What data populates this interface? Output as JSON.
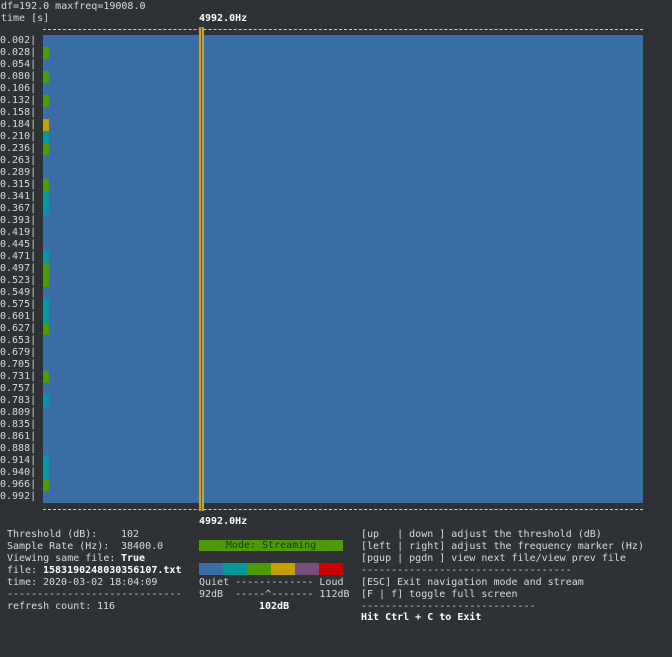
{
  "header": {
    "df_line": "df=192.0 maxfreq=19008.0",
    "time_label": "time [s]",
    "freq_marker_top": "4992.0Hz",
    "freq_marker_bottom": "4992.0Hz"
  },
  "time_labels": [
    "0.002|",
    "0.028|",
    "0.054|",
    "0.080|",
    "0.106|",
    "0.132|",
    "0.158|",
    "0.184|",
    "0.210|",
    "0.236|",
    "0.263|",
    "0.289|",
    "0.315|",
    "0.341|",
    "0.367|",
    "0.393|",
    "0.419|",
    "0.445|",
    "0.471|",
    "0.497|",
    "0.523|",
    "0.549|",
    "0.575|",
    "0.601|",
    "0.627|",
    "0.653|",
    "0.679|",
    "0.705|",
    "0.731|",
    "0.757|",
    "0.783|",
    "0.809|",
    "0.835|",
    "0.861|",
    "0.888|",
    "0.914|",
    "0.940|",
    "0.966|",
    "0.992|"
  ],
  "level_cells": [
    {
      "row": 1,
      "level": "green"
    },
    {
      "row": 3,
      "level": "green"
    },
    {
      "row": 5,
      "level": "green"
    },
    {
      "row": 7,
      "level": "yellow"
    },
    {
      "row": 8,
      "level": "teal"
    },
    {
      "row": 9,
      "level": "green"
    },
    {
      "row": 12,
      "level": "green"
    },
    {
      "row": 13,
      "level": "teal"
    },
    {
      "row": 14,
      "level": "teal"
    },
    {
      "row": 18,
      "level": "teal"
    },
    {
      "row": 19,
      "level": "green"
    },
    {
      "row": 20,
      "level": "green"
    },
    {
      "row": 22,
      "level": "teal"
    },
    {
      "row": 23,
      "level": "teal"
    },
    {
      "row": 24,
      "level": "green"
    },
    {
      "row": 28,
      "level": "green"
    },
    {
      "row": 30,
      "level": "teal"
    },
    {
      "row": 35,
      "level": "teal"
    },
    {
      "row": 36,
      "level": "teal"
    },
    {
      "row": 37,
      "level": "green"
    }
  ],
  "colors": {
    "background": "#3a6ea5",
    "marker": "#c9a227",
    "green": "#4e9a06",
    "teal": "#06989a",
    "yellow": "#c4a000",
    "purple": "#75507b",
    "red": "#cc0000"
  },
  "info": {
    "threshold_label": "Threshold (dB):",
    "threshold_value": "102",
    "sample_rate_label": "Sample Rate (Hz):",
    "sample_rate_value": "38400.0",
    "viewing_label": "Viewing same file:",
    "viewing_value": "True",
    "file_label": "file:",
    "file_value": "1583190248030356107.txt",
    "time_label": "time:",
    "time_value": "2020-03-02 18:04:09",
    "divider": "-----------------------------",
    "refresh_label": "refresh count:",
    "refresh_value": "116"
  },
  "legend": {
    "mode": "Mode: Streaming",
    "swatches": [
      "#3a6ea5",
      "#06989a",
      "#4e9a06",
      "#c4a000",
      "#75507b",
      "#cc0000"
    ],
    "scale_line": "Quiet ------------- Loud",
    "range_line": "92dB  -----^------- 112dB",
    "current_db": "102dB"
  },
  "help": {
    "line1": "[up   | down ] adjust the threshold (dB)",
    "line2": "[left | right] adjust the frequency marker (Hz)",
    "line3": "[pgup | pgdn ] view next file/view prev file",
    "divider1": "-----------------------------------",
    "line4": "[ESC] Exit navigation mode and stream",
    "line5": "[F | f] toggle full screen",
    "divider2": "-----------------------------",
    "exit": "Hit Ctrl + C to Exit"
  }
}
